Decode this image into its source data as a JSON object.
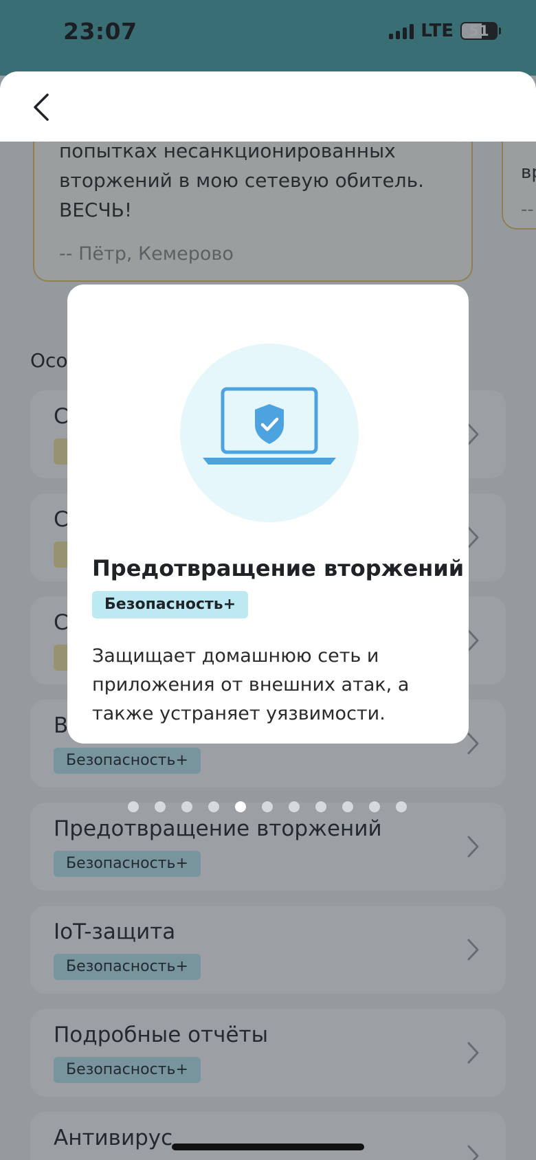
{
  "status_bar": {
    "time": "23:07",
    "network": "LTE",
    "battery": "51"
  },
  "review_main": {
    "text": "попытках несанкционированных вторжений в мою сетевую обитель. ВЕСЧЬ!",
    "author": "-- Пётр, Кемерово"
  },
  "review_side": {
    "text": "вр",
    "author": "--"
  },
  "section_title": "Осо",
  "features": [
    {
      "title": "С",
      "badge": ""
    },
    {
      "title": "С",
      "badge": ""
    },
    {
      "title": "С",
      "badge": ""
    },
    {
      "title": "В",
      "badge": "Безопасность+"
    },
    {
      "title": "Предотвращение вторжений",
      "badge": "Безопасность+"
    },
    {
      "title": "IoT-защита",
      "badge": "Безопасность+"
    },
    {
      "title": "Подробные отчёты",
      "badge": "Безопасность+"
    },
    {
      "title": "Антивирус",
      "badge": ""
    }
  ],
  "modal": {
    "title": "Предотвращение вторжений",
    "badge": "Безопасность+",
    "description": "Защищает домашнюю сеть и приложения от внешних атак, а также устраняет уязвимости.",
    "icon": "laptop-shield-icon"
  },
  "pagination": {
    "total": 11,
    "active": 5
  },
  "colors": {
    "status_bar": "#4aa3a8",
    "badge": "#bde9f2",
    "review_border": "#e8c46a",
    "hero_bg": "#e6f7fb",
    "icon_blue": "#4da3e0"
  }
}
